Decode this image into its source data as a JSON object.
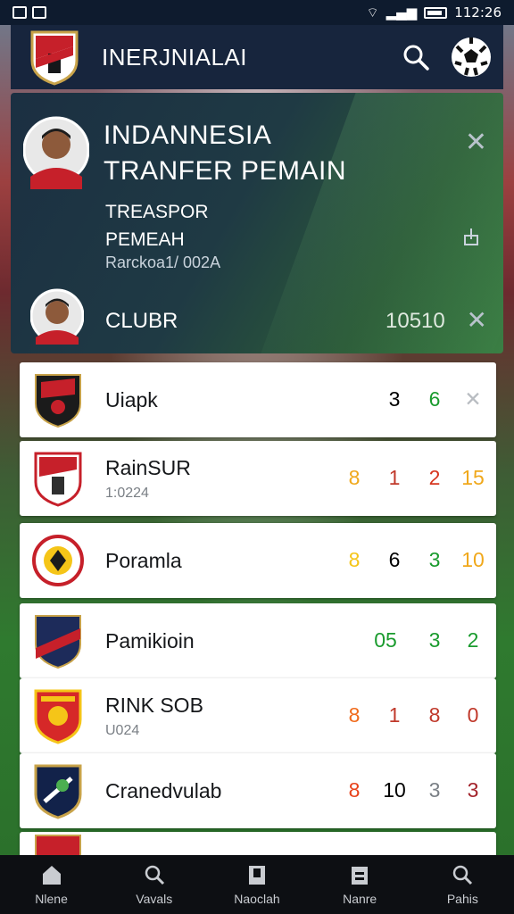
{
  "status_bar": {
    "time": "112:26"
  },
  "header": {
    "title": "INERJNIALAI",
    "logo_icon": "club-crest-icon",
    "search_icon": "search-icon",
    "ball_icon": "soccer-ball-icon"
  },
  "hero": {
    "headline_line1": "INDANNESIA",
    "headline_line2": "TRANFER PEMAIN",
    "sub_line1": "TREASPOR",
    "sub_line2": "PEMEAH",
    "meta": "Rarckoa1/ 002A",
    "club": "CLUBR",
    "score": "10510"
  },
  "rows": [
    {
      "name": "Uiapk",
      "sub": "",
      "stats": [
        {
          "v": "3",
          "c": "#15171a"
        },
        {
          "v": "6",
          "c": "#1a9b2e"
        },
        {
          "v": "✕",
          "c": "#b8bcc1"
        }
      ]
    },
    {
      "name": "RainSUR",
      "sub": "1:0224",
      "stats": [
        {
          "v": "8",
          "c": "#f0a81b"
        },
        {
          "v": "1",
          "c": "#c0392b"
        },
        {
          "v": "2",
          "c": "#d6351f"
        },
        {
          "v": "15",
          "c": "#f0a81b"
        }
      ]
    },
    {
      "name": "Poramla",
      "sub": "",
      "stats": [
        {
          "v": "8",
          "c": "#f5c518"
        },
        {
          "v": "6",
          "c": "#15171a"
        },
        {
          "v": "3",
          "c": "#1a9b2e"
        },
        {
          "v": "10",
          "c": "#f0a81b"
        }
      ]
    },
    {
      "name": "Pamikioin",
      "sub": "",
      "stats": [
        {
          "v": "05",
          "c": "#1a9b2e"
        },
        {
          "v": "3",
          "c": "#1a9b2e"
        },
        {
          "v": "2",
          "c": "#1a9b2e"
        }
      ]
    },
    {
      "name": "RINK SOB",
      "sub": "U024",
      "stats": [
        {
          "v": "8",
          "c": "#f06a1b"
        },
        {
          "v": "1",
          "c": "#c0392b"
        },
        {
          "v": "8",
          "c": "#c0392b"
        },
        {
          "v": "0",
          "c": "#c0392b"
        }
      ]
    },
    {
      "name": "Cranedvulab",
      "sub": "",
      "stats": [
        {
          "v": "8",
          "c": "#e8421b"
        },
        {
          "v": "10",
          "c": "#15171a"
        },
        {
          "v": "3",
          "c": "#7b8086"
        },
        {
          "v": "3",
          "c": "#a3232b"
        }
      ]
    }
  ],
  "nav": [
    {
      "label": "Nlene",
      "icon": "home-icon"
    },
    {
      "label": "Vavals",
      "icon": "search-icon"
    },
    {
      "label": "Naoclah",
      "icon": "bookmark-icon"
    },
    {
      "label": "Nanre",
      "icon": "calendar-icon"
    },
    {
      "label": "Pahis",
      "icon": "search-icon"
    }
  ]
}
